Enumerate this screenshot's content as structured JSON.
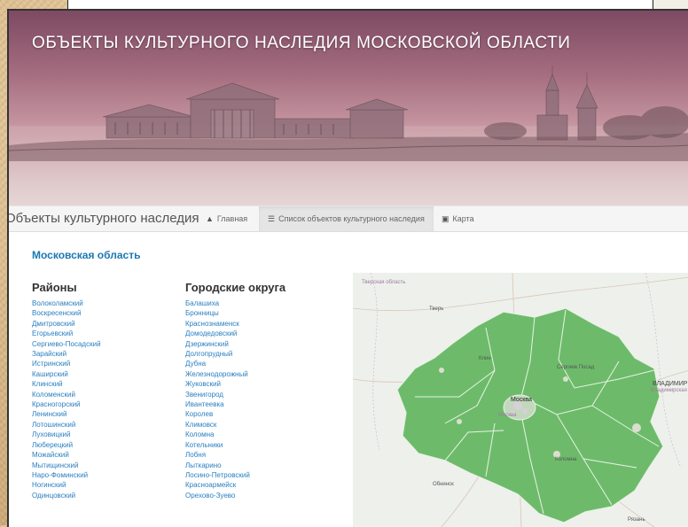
{
  "banner": {
    "title": "ОБЪЕКТЫ КУЛЬТУРНОГО НАСЛЕДИЯ МОСКОВСКОЙ ОБЛАСТИ"
  },
  "navbar": {
    "brand": "Объекты культурного наследия",
    "items": [
      {
        "label": "Главная",
        "icon": "home-icon",
        "active": false
      },
      {
        "label": "Список объектов культурного наследия",
        "icon": "list-icon",
        "active": true
      },
      {
        "label": "Карта",
        "icon": "map-image-icon",
        "active": false
      }
    ]
  },
  "main": {
    "region_title": "Московская область",
    "districts": {
      "title": "Районы",
      "items": [
        "Волоколамский",
        "Воскресенский",
        "Дмитровский",
        "Егорьевский",
        "Сергиево-Посадский",
        "Зарайский",
        "Истринский",
        "Каширский",
        "Клинский",
        "Коломенский",
        "Красногорский",
        "Ленинский",
        "Лотошинский",
        "Луховицкий",
        "Люберецкий",
        "Можайский",
        "Мытищинский",
        "Наро-Фоминский",
        "Ногинский",
        "Одинцовский"
      ]
    },
    "city_districts": {
      "title": "Городские округа",
      "items": [
        "Балашиха",
        "Бронницы",
        "Краснознаменск",
        "Домодедовский",
        "Дзержинский",
        "Долгопрудный",
        "Дубна",
        "Железнодорожный",
        "Жуковский",
        "Звенигород",
        "Ивантеевка",
        "Королев",
        "Климовск",
        "Коломна",
        "Котельники",
        "Лобня",
        "Лыткарино",
        "Лосино-Петровский",
        "Красноармейск",
        "Орехово-Зуево"
      ]
    }
  },
  "map": {
    "labels": {
      "tver_region": "Тверская область",
      "tver": "Тверь",
      "klin": "Клин",
      "sergiev_posad": "Сергиев Посад",
      "vladimir": "ВЛАДИМИР",
      "vladimir_region": "Владимирская",
      "moscow": "Москва",
      "moscow_sub": "Москва",
      "obninsk": "Обнинск",
      "ryazan": "Рязань",
      "kolomna": "Коломна"
    },
    "colors": {
      "region_fill": "#6dbb6a",
      "region_border": "#e8f2e6"
    }
  },
  "colors": {
    "link": "#2a7fc0",
    "banner_top": "#7d4a63"
  }
}
